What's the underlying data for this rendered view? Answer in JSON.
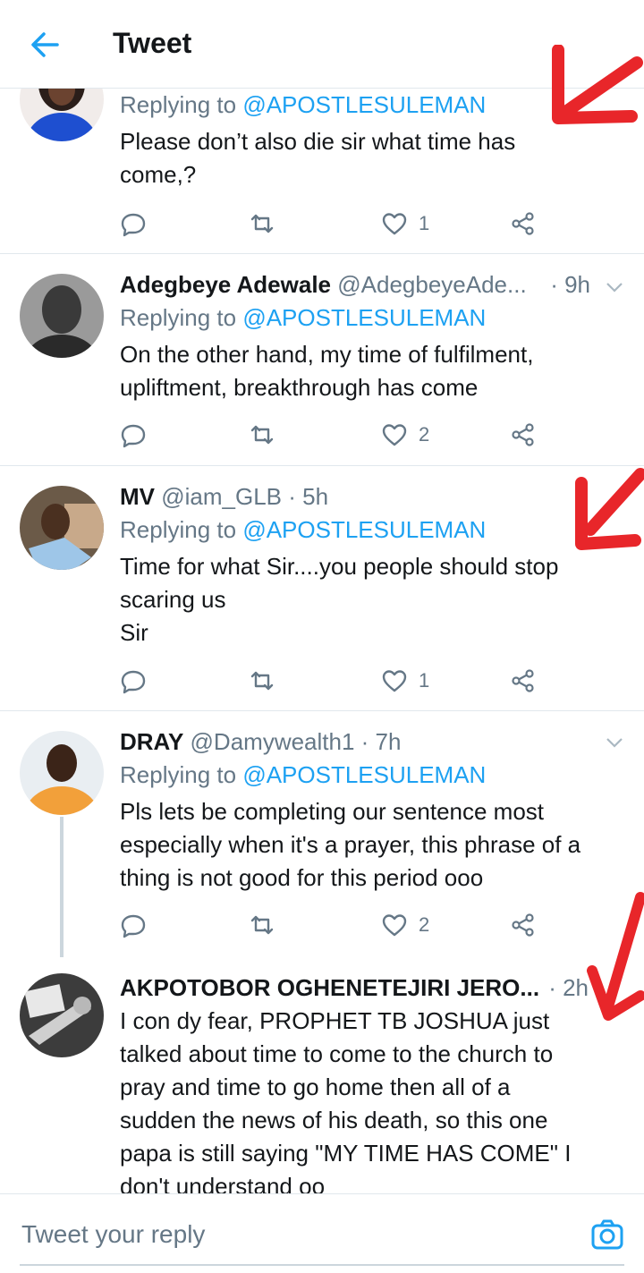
{
  "header": {
    "title": "Tweet"
  },
  "tweets": [
    {
      "name": "",
      "handle": "",
      "time": "",
      "replying_prefix": "Replying to",
      "replying_handle": "@APOSTLESULEMAN",
      "text_lines": [
        "Please don’t also die sir what time has",
        "come,?"
      ],
      "likes": "1",
      "retweets": "",
      "replies": ""
    },
    {
      "name": "Adegbeye Adewale",
      "handle": "@AdegbeyeAde...",
      "time": "· 9h",
      "replying_prefix": "Replying to",
      "replying_handle": "@APOSTLESULEMAN",
      "text_lines": [
        "On the other hand, my time of fulfilment,",
        "upliftment, breakthrough has come"
      ],
      "likes": "2",
      "retweets": "",
      "replies": ""
    },
    {
      "name": "MV",
      "handle": "@iam_GLB",
      "time": "· 5h",
      "replying_prefix": "Replying to",
      "replying_handle": "@APOSTLESULEMAN",
      "text_lines": [
        "Time for what Sir....you people should stop",
        "scaring us",
        "Sir"
      ],
      "likes": "1",
      "retweets": "",
      "replies": ""
    },
    {
      "name": "DRAY",
      "handle": "@Damywealth1",
      "time": "· 7h",
      "replying_prefix": "Replying to",
      "replying_handle": "@APOSTLESULEMAN",
      "text_lines": [
        "Pls lets be completing our sentence most",
        "especially when it's a prayer, this phrase of a",
        "thing is not good for this period ooo"
      ],
      "likes": "2",
      "retweets": "",
      "replies": ""
    },
    {
      "name": "AKPOTOBOR OGHENETEJIRI JERO...",
      "handle": "",
      "time": "· 2h",
      "text_lines": [
        "I con dy fear, PROPHET TB JOSHUA just",
        "talked about time to come to the church to",
        "pray and time to go home then all of a",
        "sudden the news of his death, so this one",
        "papa is still saying \"MY TIME HAS COME\" I",
        "don't understand oo"
      ]
    }
  ],
  "composer": {
    "placeholder": "Tweet your reply"
  },
  "colors": {
    "accent": "#1da1f2",
    "muted": "#657786",
    "annotation": "#e8262a"
  },
  "icons": [
    "back-arrow-icon",
    "chevron-down-icon",
    "reply-icon",
    "retweet-icon",
    "like-icon",
    "share-icon",
    "camera-icon"
  ]
}
